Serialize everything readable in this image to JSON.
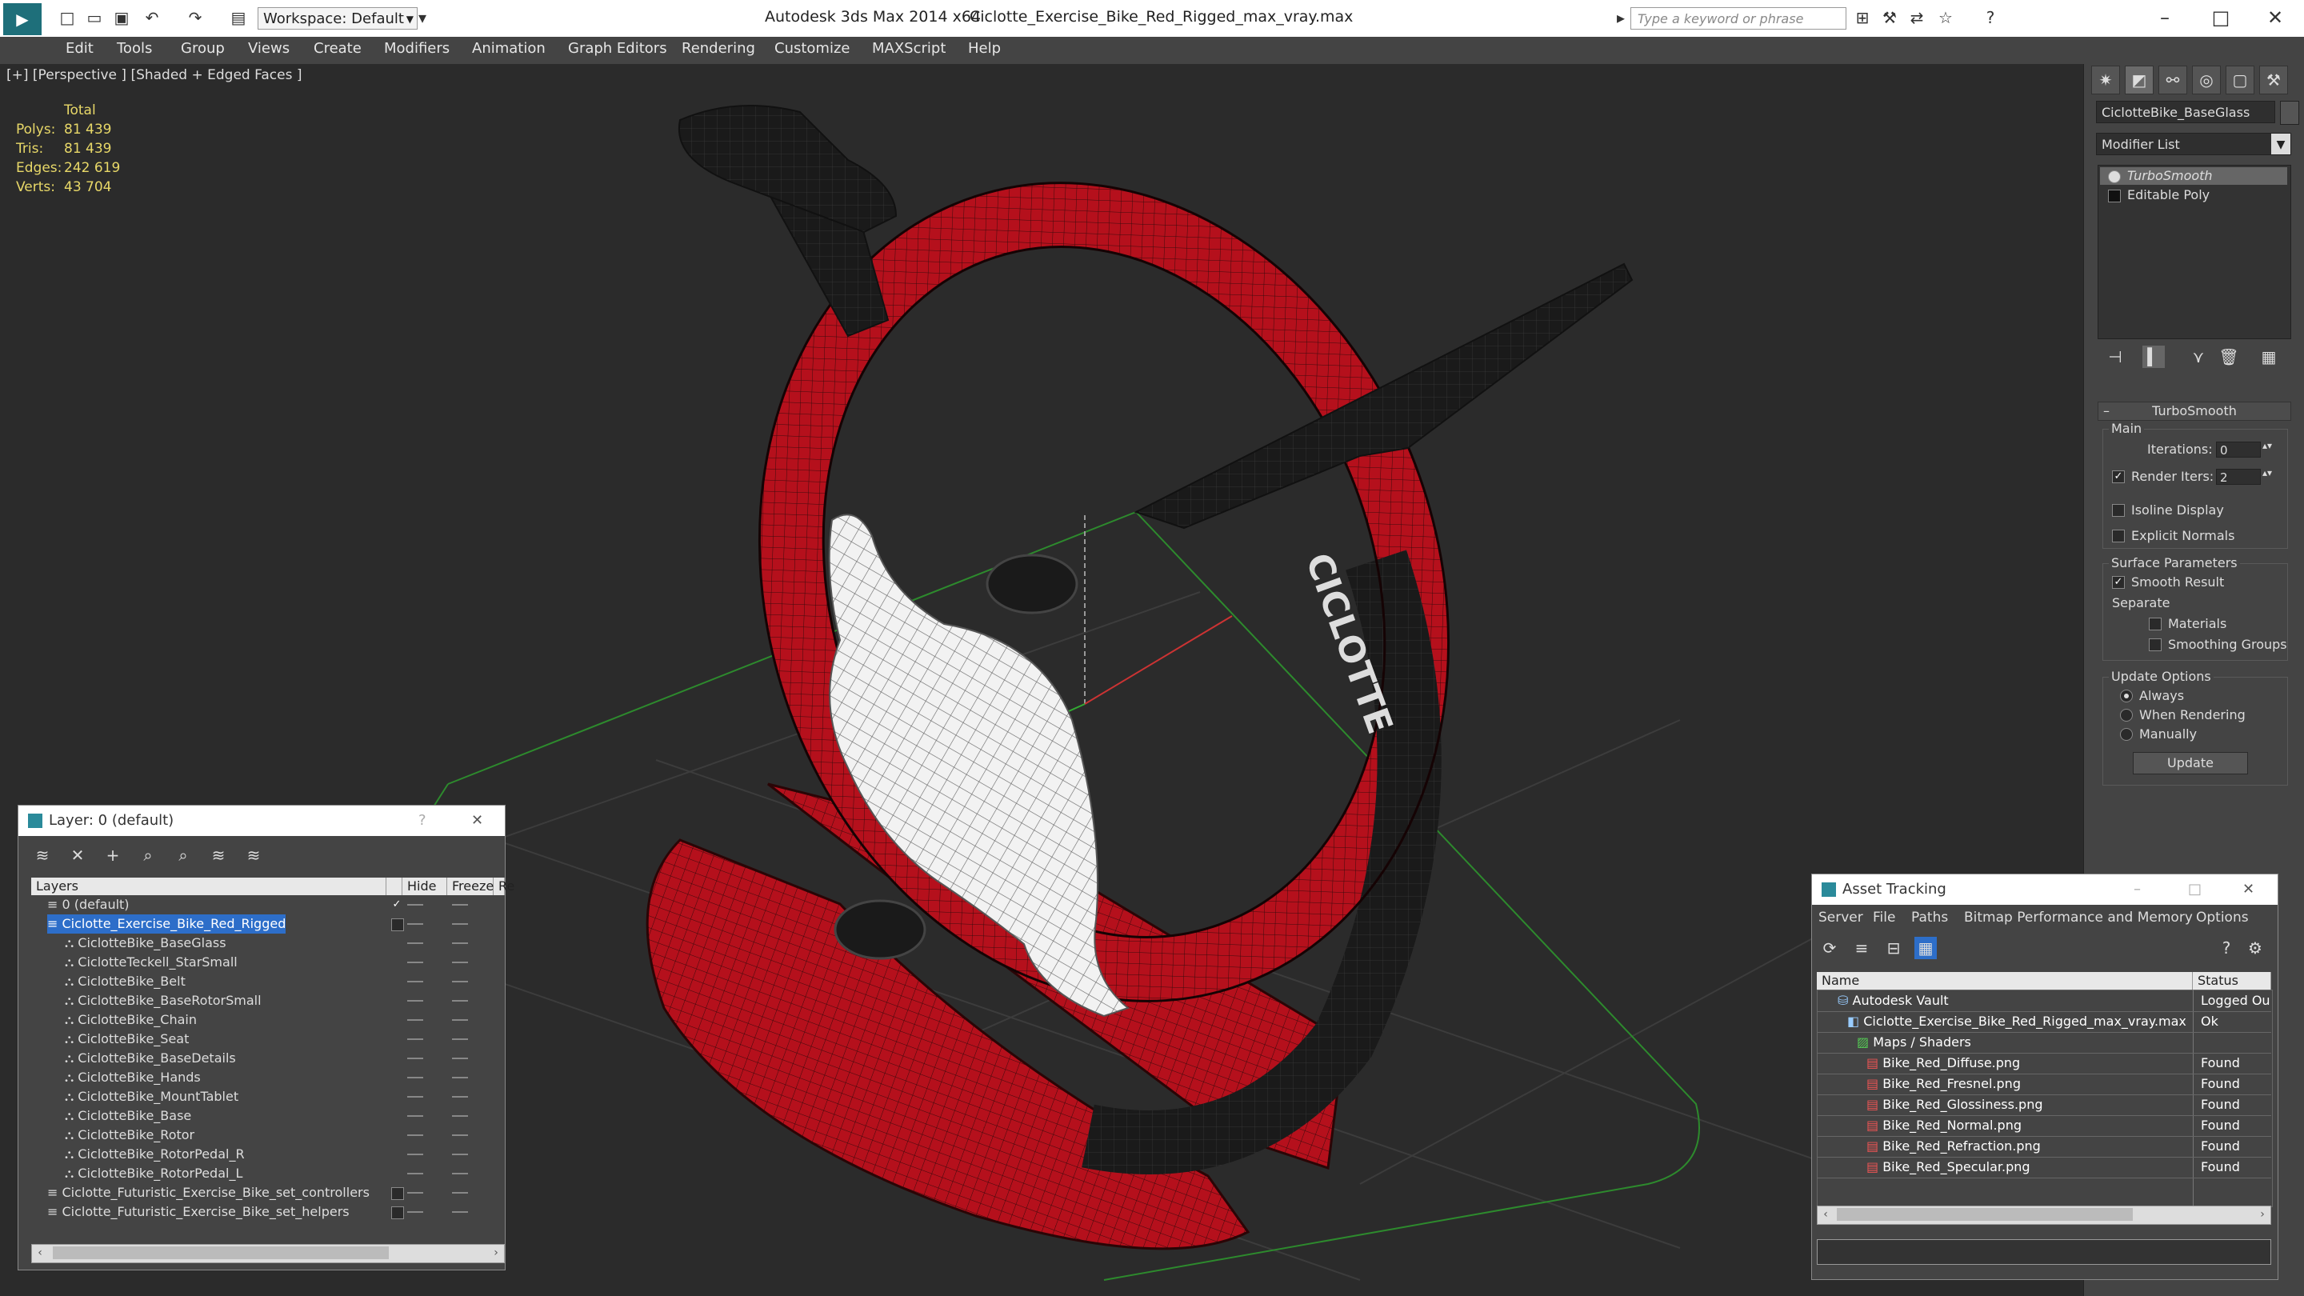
{
  "titlebar": {
    "workspace": "Workspace: Default",
    "app_title": "Autodesk 3ds Max  2014 x64",
    "file_title": "Ciclotte_Exercise_Bike_Red_Rigged_max_vray.max",
    "search_placeholder": "Type a keyword or phrase"
  },
  "menu": [
    "Edit",
    "Tools",
    "Group",
    "Views",
    "Create",
    "Modifiers",
    "Animation",
    "Graph Editors",
    "Rendering",
    "Customize",
    "MAXScript",
    "Help"
  ],
  "viewport": {
    "label": "[+] [Perspective ] [Shaded + Edged Faces ]",
    "stats_header": "Total",
    "stats": [
      {
        "k": "Polys:",
        "v": "81 439"
      },
      {
        "k": "Tris:",
        "v": "81 439"
      },
      {
        "k": "Edges:",
        "v": "242 619"
      },
      {
        "k": "Verts:",
        "v": "43 704"
      }
    ],
    "logo_text": "CICLOTTE"
  },
  "command_panel": {
    "object_name": "CiclotteBike_BaseGlass",
    "modifier_list": "Modifier List",
    "stack": [
      "TurboSmooth",
      "Editable Poly"
    ],
    "rollout_title": "TurboSmooth",
    "main_group": "Main",
    "iterations_label": "Iterations:",
    "iterations_value": "0",
    "render_iters_label": "Render Iters:",
    "render_iters_value": "2",
    "isoline": "Isoline Display",
    "explicit_normals": "Explicit Normals",
    "surface_group": "Surface Parameters",
    "smooth_result": "Smooth Result",
    "separate": "Separate",
    "materials": "Materials",
    "smoothing_groups": "Smoothing Groups",
    "update_group": "Update Options",
    "always": "Always",
    "when_rendering": "When Rendering",
    "manually": "Manually",
    "update_button": "Update"
  },
  "layer_window": {
    "title": "Layer: 0 (default)",
    "help": "?",
    "col_layers": "Layers",
    "col_hide": "Hide",
    "col_freeze": "Freeze",
    "col_r": "Re",
    "rows": [
      "0 (default)",
      "Ciclotte_Exercise_Bike_Red_Rigged",
      "CiclotteBike_BaseGlass",
      "CiclotteTeckell_StarSmall",
      "CiclotteBike_Belt",
      "CiclotteBike_BaseRotorSmall",
      "CiclotteBike_Chain",
      "CiclotteBike_Seat",
      "CiclotteBike_BaseDetails",
      "CiclotteBike_Hands",
      "CiclotteBike_MountTablet",
      "CiclotteBike_Base",
      "CiclotteBike_Rotor",
      "CiclotteBike_RotorPedal_R",
      "CiclotteBike_RotorPedal_L",
      "Ciclotte_Futuristic_Exercise_Bike_set_controllers",
      "Ciclotte_Futuristic_Exercise_Bike_set_helpers"
    ]
  },
  "asset_window": {
    "title": "Asset Tracking",
    "menu": [
      "Server",
      "File",
      "Paths",
      "Bitmap Performance and Memory",
      "Options"
    ],
    "col_name": "Name",
    "col_status": "Status",
    "rows": [
      {
        "name": "Autodesk Vault",
        "status": "Logged Ou"
      },
      {
        "name": "Ciclotte_Exercise_Bike_Red_Rigged_max_vray.max",
        "status": "Ok"
      },
      {
        "name": "Maps / Shaders",
        "status": ""
      },
      {
        "name": "Bike_Red_Diffuse.png",
        "status": "Found"
      },
      {
        "name": "Bike_Red_Fresnel.png",
        "status": "Found"
      },
      {
        "name": "Bike_Red_Glossiness.png",
        "status": "Found"
      },
      {
        "name": "Bike_Red_Normal.png",
        "status": "Found"
      },
      {
        "name": "Bike_Red_Refraction.png",
        "status": "Found"
      },
      {
        "name": "Bike_Red_Specular.png",
        "status": "Found"
      }
    ]
  }
}
